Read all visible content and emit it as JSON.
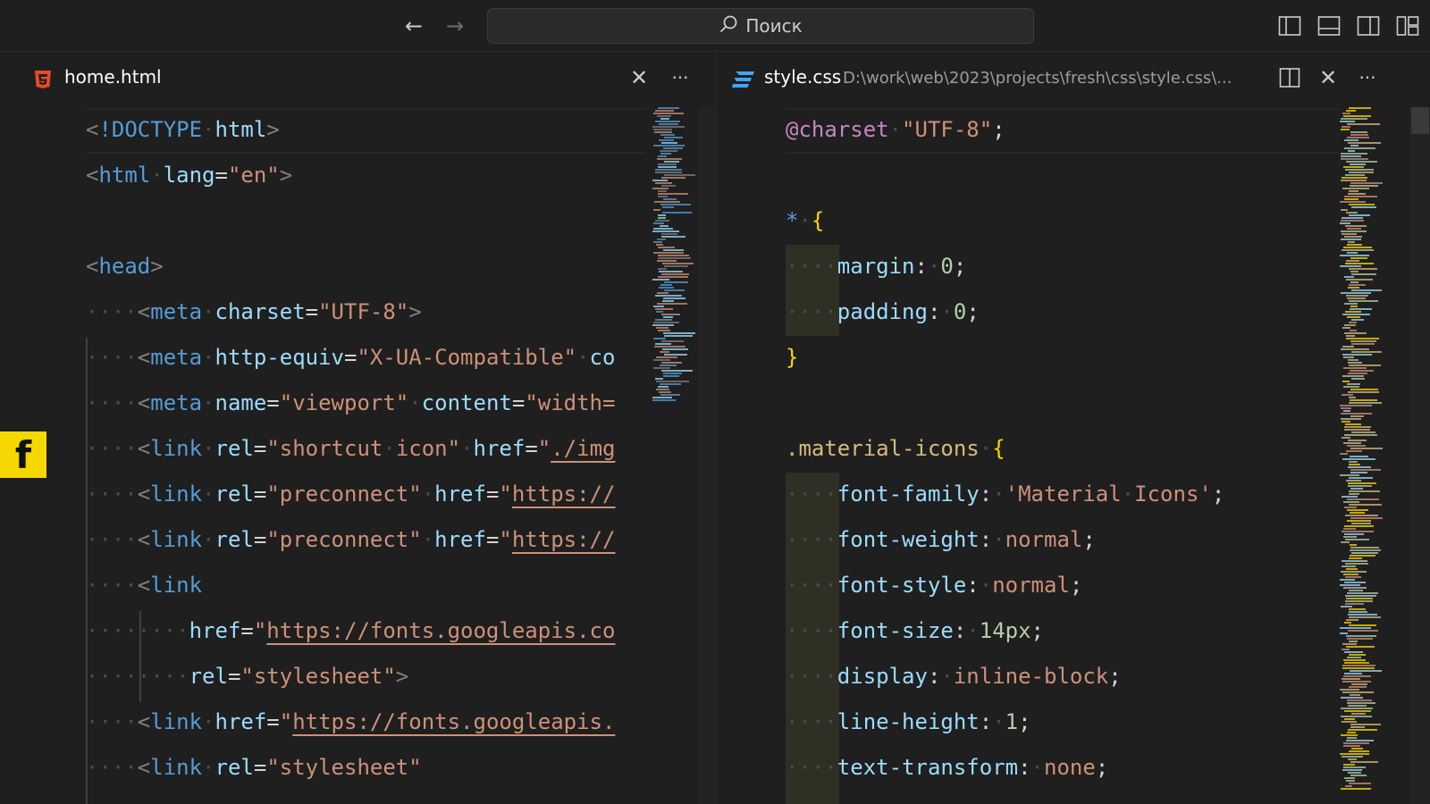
{
  "titlebar": {
    "back_label": "←",
    "forward_label": "→",
    "search_placeholder": "Поиск"
  },
  "left_editor": {
    "tab_title": "home.html",
    "close_label": "✕",
    "more_label": "···",
    "lines": [
      [
        [
          "punc",
          "<"
        ],
        [
          "tag",
          "!DOCTYPE"
        ],
        [
          "ws",
          "·"
        ],
        [
          "attr",
          "html"
        ],
        [
          "punc",
          ">"
        ]
      ],
      [
        [
          "punc",
          "<"
        ],
        [
          "tag",
          "html"
        ],
        [
          "ws",
          "·"
        ],
        [
          "attr",
          "lang"
        ],
        [
          "plain",
          "="
        ],
        [
          "str",
          "\"en\""
        ],
        [
          "punc",
          ">"
        ]
      ],
      [],
      [
        [
          "punc",
          "<"
        ],
        [
          "tag",
          "head"
        ],
        [
          "punc",
          ">"
        ]
      ],
      [
        [
          "ws",
          "····"
        ],
        [
          "punc",
          "<"
        ],
        [
          "tag",
          "meta"
        ],
        [
          "ws",
          "·"
        ],
        [
          "attr",
          "charset"
        ],
        [
          "plain",
          "="
        ],
        [
          "str",
          "\"UTF-8\""
        ],
        [
          "punc",
          ">"
        ]
      ],
      [
        [
          "ws",
          "····"
        ],
        [
          "punc",
          "<"
        ],
        [
          "tag",
          "meta"
        ],
        [
          "ws",
          "·"
        ],
        [
          "attr",
          "http-equiv"
        ],
        [
          "plain",
          "="
        ],
        [
          "str",
          "\"X-UA-Compatible\""
        ],
        [
          "ws",
          "·"
        ],
        [
          "attr",
          "co"
        ]
      ],
      [
        [
          "ws",
          "····"
        ],
        [
          "punc",
          "<"
        ],
        [
          "tag",
          "meta"
        ],
        [
          "ws",
          "·"
        ],
        [
          "attr",
          "name"
        ],
        [
          "plain",
          "="
        ],
        [
          "str",
          "\"viewport\""
        ],
        [
          "ws",
          "·"
        ],
        [
          "attr",
          "content"
        ],
        [
          "plain",
          "="
        ],
        [
          "str",
          "\"width="
        ]
      ],
      [
        [
          "ws",
          "····"
        ],
        [
          "punc",
          "<"
        ],
        [
          "tag",
          "link"
        ],
        [
          "ws",
          "·"
        ],
        [
          "attr",
          "rel"
        ],
        [
          "plain",
          "="
        ],
        [
          "str",
          "\"shortcut"
        ],
        [
          "ws",
          "·"
        ],
        [
          "str",
          "icon\""
        ],
        [
          "ws",
          "·"
        ],
        [
          "attr",
          "href"
        ],
        [
          "plain",
          "="
        ],
        [
          "str",
          "\""
        ],
        [
          "url",
          "./img"
        ]
      ],
      [
        [
          "ws",
          "····"
        ],
        [
          "punc",
          "<"
        ],
        [
          "tag",
          "link"
        ],
        [
          "ws",
          "·"
        ],
        [
          "attr",
          "rel"
        ],
        [
          "plain",
          "="
        ],
        [
          "str",
          "\"preconnect\""
        ],
        [
          "ws",
          "·"
        ],
        [
          "attr",
          "href"
        ],
        [
          "plain",
          "="
        ],
        [
          "str",
          "\""
        ],
        [
          "url",
          "https://"
        ]
      ],
      [
        [
          "ws",
          "····"
        ],
        [
          "punc",
          "<"
        ],
        [
          "tag",
          "link"
        ],
        [
          "ws",
          "·"
        ],
        [
          "attr",
          "rel"
        ],
        [
          "plain",
          "="
        ],
        [
          "str",
          "\"preconnect\""
        ],
        [
          "ws",
          "·"
        ],
        [
          "attr",
          "href"
        ],
        [
          "plain",
          "="
        ],
        [
          "str",
          "\""
        ],
        [
          "url",
          "https://"
        ]
      ],
      [
        [
          "ws",
          "····"
        ],
        [
          "punc",
          "<"
        ],
        [
          "tag",
          "link"
        ]
      ],
      [
        [
          "ws",
          "········"
        ],
        [
          "attr",
          "href"
        ],
        [
          "plain",
          "="
        ],
        [
          "str",
          "\""
        ],
        [
          "url",
          "https://fonts.googleapis.co"
        ]
      ],
      [
        [
          "ws",
          "········"
        ],
        [
          "attr",
          "rel"
        ],
        [
          "plain",
          "="
        ],
        [
          "str",
          "\"stylesheet\""
        ],
        [
          "punc",
          ">"
        ]
      ],
      [
        [
          "ws",
          "····"
        ],
        [
          "punc",
          "<"
        ],
        [
          "tag",
          "link"
        ],
        [
          "ws",
          "·"
        ],
        [
          "attr",
          "href"
        ],
        [
          "plain",
          "="
        ],
        [
          "str",
          "\""
        ],
        [
          "url",
          "https://fonts.googleapis."
        ]
      ],
      [
        [
          "ws",
          "····"
        ],
        [
          "punc",
          "<"
        ],
        [
          "tag",
          "link"
        ],
        [
          "ws",
          "·"
        ],
        [
          "attr",
          "rel"
        ],
        [
          "plain",
          "="
        ],
        [
          "str",
          "\"stylesheet\""
        ]
      ]
    ]
  },
  "right_editor": {
    "tab_title": "style.css",
    "tab_path": "D:\\work\\web\\2023\\projects\\fresh\\css\\style.css\\...",
    "close_label": "✕",
    "more_label": "···",
    "lines": [
      [
        [
          "kw",
          "@charset"
        ],
        [
          "ws",
          "·"
        ],
        [
          "str",
          "\"UTF-8\""
        ],
        [
          "plain",
          ";"
        ]
      ],
      [],
      [
        [
          "tag",
          "*"
        ],
        [
          "ws",
          "·"
        ],
        [
          "brace",
          "{"
        ]
      ],
      [
        [
          "ws",
          "····"
        ],
        [
          "prop",
          "margin"
        ],
        [
          "plain",
          ":"
        ],
        [
          "ws",
          "·"
        ],
        [
          "num",
          "0"
        ],
        [
          "plain",
          ";"
        ]
      ],
      [
        [
          "ws",
          "····"
        ],
        [
          "prop",
          "padding"
        ],
        [
          "plain",
          ":"
        ],
        [
          "ws",
          "·"
        ],
        [
          "num",
          "0"
        ],
        [
          "plain",
          ";"
        ]
      ],
      [
        [
          "brace",
          "}"
        ]
      ],
      [],
      [
        [
          "sel",
          ".material-icons"
        ],
        [
          "ws",
          "·"
        ],
        [
          "brace",
          "{"
        ]
      ],
      [
        [
          "ws",
          "····"
        ],
        [
          "prop",
          "font-family"
        ],
        [
          "plain",
          ":"
        ],
        [
          "ws",
          "·"
        ],
        [
          "str",
          "'Material"
        ],
        [
          "ws",
          "·"
        ],
        [
          "str",
          "Icons'"
        ],
        [
          "plain",
          ";"
        ]
      ],
      [
        [
          "ws",
          "····"
        ],
        [
          "prop",
          "font-weight"
        ],
        [
          "plain",
          ":"
        ],
        [
          "ws",
          "·"
        ],
        [
          "str",
          "normal"
        ],
        [
          "plain",
          ";"
        ]
      ],
      [
        [
          "ws",
          "····"
        ],
        [
          "prop",
          "font-style"
        ],
        [
          "plain",
          ":"
        ],
        [
          "ws",
          "·"
        ],
        [
          "str",
          "normal"
        ],
        [
          "plain",
          ";"
        ]
      ],
      [
        [
          "ws",
          "····"
        ],
        [
          "prop",
          "font-size"
        ],
        [
          "plain",
          ":"
        ],
        [
          "ws",
          "·"
        ],
        [
          "num",
          "14px"
        ],
        [
          "plain",
          ";"
        ]
      ],
      [
        [
          "ws",
          "····"
        ],
        [
          "prop",
          "display"
        ],
        [
          "plain",
          ":"
        ],
        [
          "ws",
          "·"
        ],
        [
          "str",
          "inline-block"
        ],
        [
          "plain",
          ";"
        ]
      ],
      [
        [
          "ws",
          "····"
        ],
        [
          "prop",
          "line-height"
        ],
        [
          "plain",
          ":"
        ],
        [
          "ws",
          "·"
        ],
        [
          "num",
          "1"
        ],
        [
          "plain",
          ";"
        ]
      ],
      [
        [
          "ws",
          "····"
        ],
        [
          "prop",
          "text-transform"
        ],
        [
          "plain",
          ":"
        ],
        [
          "ws",
          "·"
        ],
        [
          "str",
          "none"
        ],
        [
          "plain",
          ";"
        ]
      ]
    ]
  },
  "overlay_badge": {
    "label": "f",
    "color": "#f5d800"
  },
  "colors": {
    "background": "#1f1f1f",
    "tag": "#569cd6",
    "attribute": "#9cdcfe",
    "string": "#ce9178",
    "number": "#b5cea8",
    "keyword": "#c586c0",
    "selector": "#d7ba7d",
    "brace": "#ffd700",
    "html_icon": "#e44d26",
    "css_icon": "#42a5f5"
  }
}
